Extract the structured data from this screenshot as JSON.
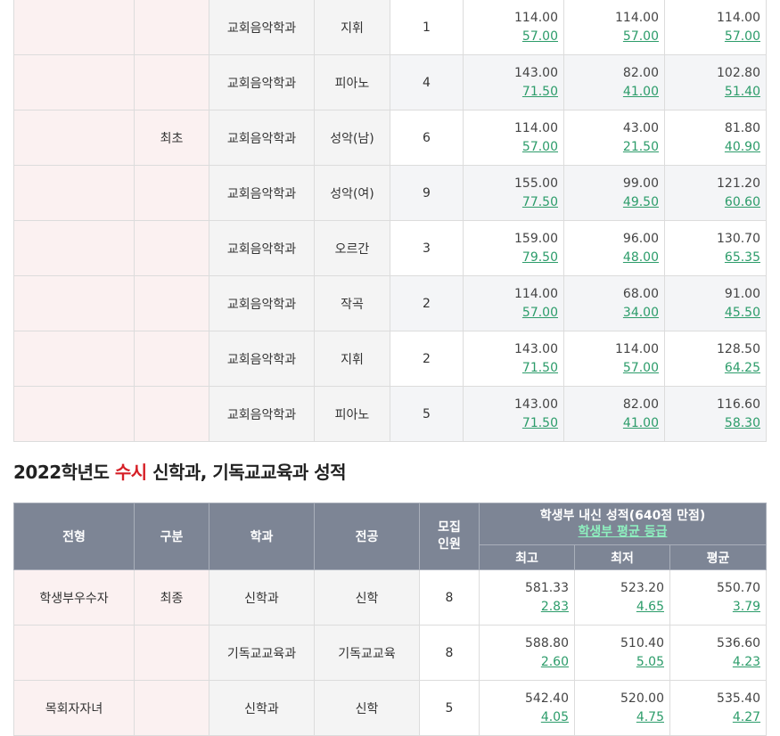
{
  "table1": {
    "rows": [
      {
        "type": "",
        "division": "",
        "dept": "교회음악학과",
        "major": "지휘",
        "count": "1",
        "max": "114.00",
        "max_grade": "57.00",
        "min": "114.00",
        "min_grade": "57.00",
        "avg": "114.00",
        "avg_grade": "57.00"
      },
      {
        "type": "",
        "division": "",
        "dept": "교회음악학과",
        "major": "피아노",
        "count": "4",
        "max": "143.00",
        "max_grade": "71.50",
        "min": "82.00",
        "min_grade": "41.00",
        "avg": "102.80",
        "avg_grade": "51.40"
      },
      {
        "type": "",
        "division": "최초",
        "dept": "교회음악학과",
        "major": "성악(남)",
        "count": "6",
        "max": "114.00",
        "max_grade": "57.00",
        "min": "43.00",
        "min_grade": "21.50",
        "avg": "81.80",
        "avg_grade": "40.90"
      },
      {
        "type": "",
        "division": "",
        "dept": "교회음악학과",
        "major": "성악(여)",
        "count": "9",
        "max": "155.00",
        "max_grade": "77.50",
        "min": "99.00",
        "min_grade": "49.50",
        "avg": "121.20",
        "avg_grade": "60.60"
      },
      {
        "type": "",
        "division": "",
        "dept": "교회음악학과",
        "major": "오르간",
        "count": "3",
        "max": "159.00",
        "max_grade": "79.50",
        "min": "96.00",
        "min_grade": "48.00",
        "avg": "130.70",
        "avg_grade": "65.35"
      },
      {
        "type": "",
        "division": "",
        "dept": "교회음악학과",
        "major": "작곡",
        "count": "2",
        "max": "114.00",
        "max_grade": "57.00",
        "min": "68.00",
        "min_grade": "34.00",
        "avg": "91.00",
        "avg_grade": "45.50"
      },
      {
        "type": "",
        "division": "",
        "dept": "교회음악학과",
        "major": "지휘",
        "count": "2",
        "max": "143.00",
        "max_grade": "71.50",
        "min": "114.00",
        "min_grade": "57.00",
        "avg": "128.50",
        "avg_grade": "64.25"
      },
      {
        "type": "",
        "division": "",
        "dept": "교회음악학과",
        "major": "피아노",
        "count": "5",
        "max": "143.00",
        "max_grade": "71.50",
        "min": "82.00",
        "min_grade": "41.00",
        "avg": "116.60",
        "avg_grade": "58.30"
      }
    ]
  },
  "section2": {
    "title_prefix": "2022학년도 ",
    "title_highlight": "수시",
    "title_suffix": " 신학과, 기독교교육과 성적"
  },
  "table2": {
    "headers": {
      "type": "전형",
      "division": "구분",
      "dept": "학과",
      "major": "전공",
      "count_line1": "모집",
      "count_line2": "인원",
      "group_title": "학생부 내신 성적(640점 만점)",
      "group_link": "학생부 평균 등급",
      "max": "최고",
      "min": "최저",
      "avg": "평균"
    },
    "rows": [
      {
        "type": "학생부우수자",
        "division": "최종",
        "dept": "신학과",
        "major": "신학",
        "count": "8",
        "max": "581.33",
        "max_grade": "2.83",
        "min": "523.20",
        "min_grade": "4.65",
        "avg": "550.70",
        "avg_grade": "3.79"
      },
      {
        "type": "",
        "division": "",
        "dept": "기독교교육과",
        "major": "기독교교육",
        "count": "8",
        "max": "588.80",
        "max_grade": "2.60",
        "min": "510.40",
        "min_grade": "5.05",
        "avg": "536.60",
        "avg_grade": "4.23"
      },
      {
        "type": "목회자자녀",
        "division": "",
        "dept": "신학과",
        "major": "신학",
        "count": "5",
        "max": "542.40",
        "max_grade": "4.05",
        "min": "520.00",
        "min_grade": "4.75",
        "avg": "535.40",
        "avg_grade": "4.27"
      }
    ]
  },
  "colors": {
    "highlight": "#d61f26",
    "grade_link": "#2c9c6a",
    "header_bg": "#7d8595",
    "pink_cell": "#fbf1f1"
  }
}
